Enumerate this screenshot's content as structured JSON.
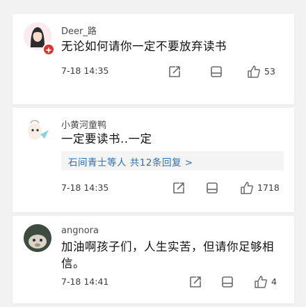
{
  "comments": [
    {
      "username": "Deer_路",
      "text": "无论如何请你一定不要放弃读书",
      "time": "7-18 14:35",
      "likes": "53",
      "has_badge": true
    },
    {
      "username": "小黄河童鸭",
      "text": "一定要读书..一定",
      "reply_link": "石间青士等人 共12条回复 >",
      "time": "7-18 14:35",
      "likes": "1718"
    },
    {
      "username": "angnora",
      "text_line1": "加油啊孩子们，人生实苦，但请你足够相",
      "text_line2": "信。",
      "time": "7-18 14:41",
      "likes": "4"
    }
  ],
  "icons": {
    "share": "share-icon",
    "comment": "comment-icon",
    "like": "thumbs-up-icon",
    "badge": "add-badge-icon"
  },
  "colors": {
    "badge": "#e0322f",
    "link": "#2f6fb3",
    "icon_stroke": "#6a6a6a"
  }
}
